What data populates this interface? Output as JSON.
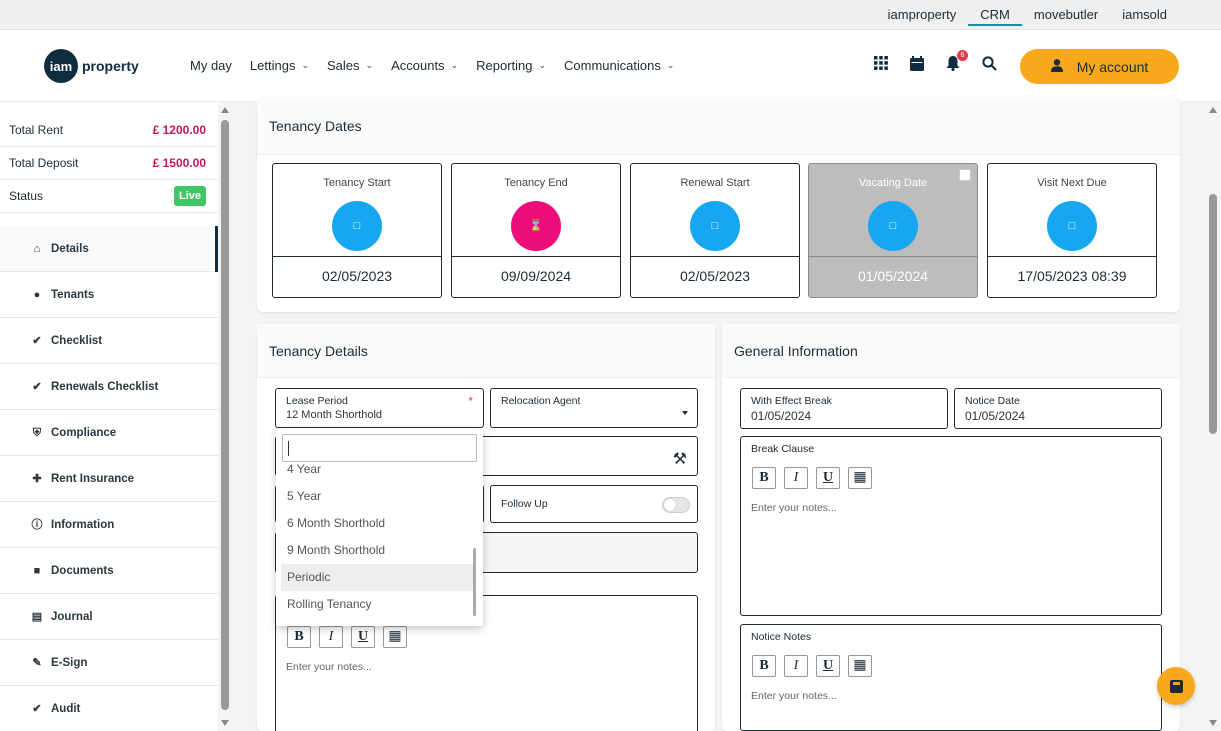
{
  "brand_links": [
    "iamproperty",
    "CRM",
    "movebutler",
    "iamsold"
  ],
  "logo": {
    "mark": "iam",
    "word": "property"
  },
  "nav": [
    "My day",
    "Lettings",
    "Sales",
    "Accounts",
    "Reporting",
    "Communications"
  ],
  "header": {
    "notification_count": "6",
    "account_label": "My account"
  },
  "summary": {
    "total_rent_label": "Total Rent",
    "total_rent": "£ 1200.00",
    "total_deposit_label": "Total Deposit",
    "total_deposit": "£ 1500.00",
    "status_label": "Status",
    "status": "Live"
  },
  "menu": [
    "Details",
    "Tenants",
    "Checklist",
    "Renewals Checklist",
    "Compliance",
    "Rent Insurance",
    "Information",
    "Documents",
    "Journal",
    "E-Sign",
    "Audit"
  ],
  "tenancy_dates": {
    "title": "Tenancy Dates",
    "boxes": [
      {
        "label": "Tenancy Start",
        "date": "02/05/2023"
      },
      {
        "label": "Tenancy End",
        "date": "09/09/2024"
      },
      {
        "label": "Renewal Start",
        "date": "02/05/2023"
      },
      {
        "label": "Vacating Date",
        "date": "01/05/2024"
      },
      {
        "label": "Visit Next Due",
        "date": "17/05/2023 08:39"
      }
    ]
  },
  "tenancy_details": {
    "title": "Tenancy Details",
    "lease_period_label": "Lease Period",
    "lease_period_value": "12 Month Shorthold",
    "relocation_agent_label": "Relocation Agent",
    "follow_up_label": "Follow Up",
    "notes_placeholder": "Enter your notes..."
  },
  "dropdown": {
    "search_value": "",
    "options": [
      "4 Year",
      "5 Year",
      "6 Month Shorthold",
      "9 Month Shorthold",
      "Periodic",
      "Rolling Tenancy"
    ],
    "highlighted": "Periodic"
  },
  "general_info": {
    "title": "General Information",
    "with_effect_break_label": "With Effect Break",
    "with_effect_break_value": "01/05/2024",
    "notice_date_label": "Notice Date",
    "notice_date_value": "01/05/2024",
    "break_clause_label": "Break Clause",
    "notice_notes_label": "Notice Notes",
    "notes_placeholder": "Enter your notes..."
  },
  "editor_buttons": [
    "B",
    "I",
    "U"
  ],
  "colors": {
    "accent": "#f8a81b",
    "navy": "#0f2d3e",
    "date_blue": "#16a7f0",
    "date_pink": "#ee0e7a",
    "live_green": "#3fc767",
    "money": "#c2185b"
  }
}
